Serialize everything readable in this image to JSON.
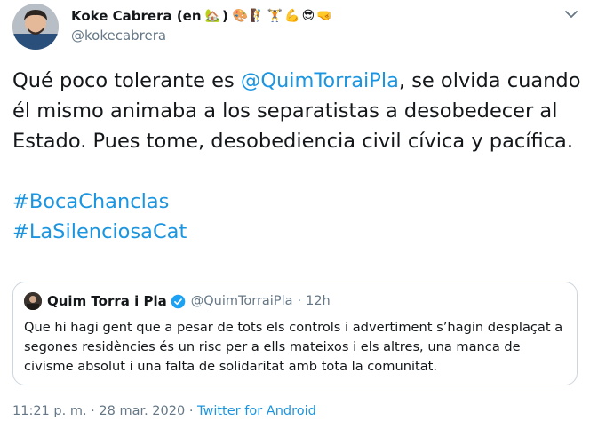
{
  "author": {
    "name": "Koke Cabrera (en",
    "emoji": [
      "🏡",
      ")",
      "🎨",
      "🧗",
      "🏋",
      "💪",
      "😎",
      "🤜"
    ],
    "handle": "@kokecabrera"
  },
  "tweet": {
    "text_before": "Qué poco tolerante es ",
    "mention": "@QuimTorraiPla",
    "text_after": ", se olvida cuando él mismo animaba a los separatistas a desobedecer al Estado. Pues tome, desobediencia civil cívica y pacífica.",
    "hashtags": [
      "#BocaChanclas",
      "#LaSilenciosaCat"
    ]
  },
  "quoted": {
    "name": "Quim Torra i Pla",
    "handle": "@QuimTorraiPla",
    "separator": "·",
    "time": "12h",
    "text": "Que hi hagi gent que a pesar de tots els controls i advertiment s’hagin desplaçat a segones residències és un risc per a ells mateixos i els altres, una manca de civisme absolut i una falta de solidaritat amb tota la comunitat."
  },
  "meta": {
    "timestamp": "11:21 p. m. · 28 mar. 2020",
    "separator": "·",
    "source": "Twitter for Android"
  },
  "icons": {
    "caret": "chevron-down-icon",
    "verified": "verified-badge-icon"
  },
  "colors": {
    "link": "#1b95e0",
    "secondary_text": "#657786",
    "border": "#ccd6dd"
  }
}
